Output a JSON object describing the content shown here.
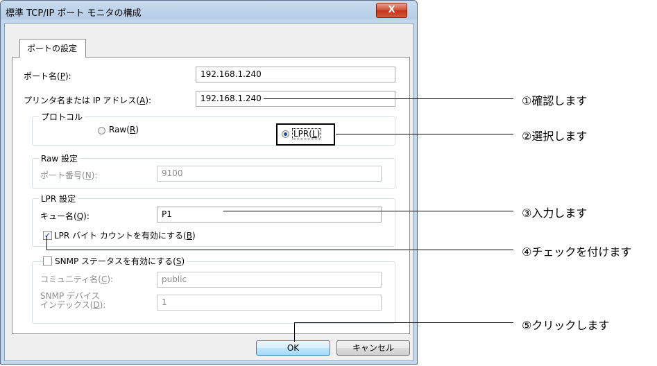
{
  "window": {
    "title": "標準 TCP/IP ポート モニタの構成",
    "close_glyph": "X"
  },
  "tab": {
    "label": "ポートの設定"
  },
  "port_name": {
    "label": "ポート名(",
    "key": "P",
    "label_end": "):",
    "value": "192.168.1.240"
  },
  "printer_name": {
    "label": "プリンタ名または IP アドレス(",
    "key": "A",
    "label_end": "):",
    "value": "192.168.1.240"
  },
  "protocol": {
    "legend": "プロトコル",
    "raw": {
      "label": "Raw(",
      "key": "R",
      "label_end": ")",
      "selected": false
    },
    "lpr": {
      "label": "LPR(",
      "key": "L",
      "label_end": ")",
      "selected": true
    }
  },
  "raw_settings": {
    "legend": "Raw 設定",
    "port_number": {
      "label": "ポート番号(",
      "key": "N",
      "label_end": "):",
      "value": "9100"
    }
  },
  "lpr_settings": {
    "legend": "LPR 設定",
    "queue_name": {
      "label": "キュー名(",
      "key": "Q",
      "label_end": "):",
      "value": "P1"
    },
    "byte_count": {
      "label": "LPR バイト カウントを有効にする(",
      "key": "B",
      "label_end": ")",
      "checked": true
    }
  },
  "snmp": {
    "label": "SNMP ステータスを有効にする(",
    "key": "S",
    "label_end": ")",
    "checked": false,
    "community": {
      "label": "コミュニティ名(",
      "key": "C",
      "label_end": "):",
      "value": "public"
    },
    "device_index": {
      "label_line1": "SNMP デバイス",
      "label_line2": "インデックス(",
      "key": "D",
      "label_end": "):",
      "value": "1"
    }
  },
  "buttons": {
    "ok": "OK",
    "cancel": "キャンセル"
  },
  "callouts": {
    "c1": "①確認します",
    "c2": "②選択します",
    "c3": "③入力します",
    "c4": "④チェックを付けます",
    "c5": "⑤クリックします"
  },
  "icons": {
    "radio_selected": "radio-selected",
    "checkbox_checked": "checkmark"
  },
  "colors": {
    "title_bar": "#c2d6ec",
    "close_button": "#c8442a",
    "ok_button": "#bee6fd"
  }
}
